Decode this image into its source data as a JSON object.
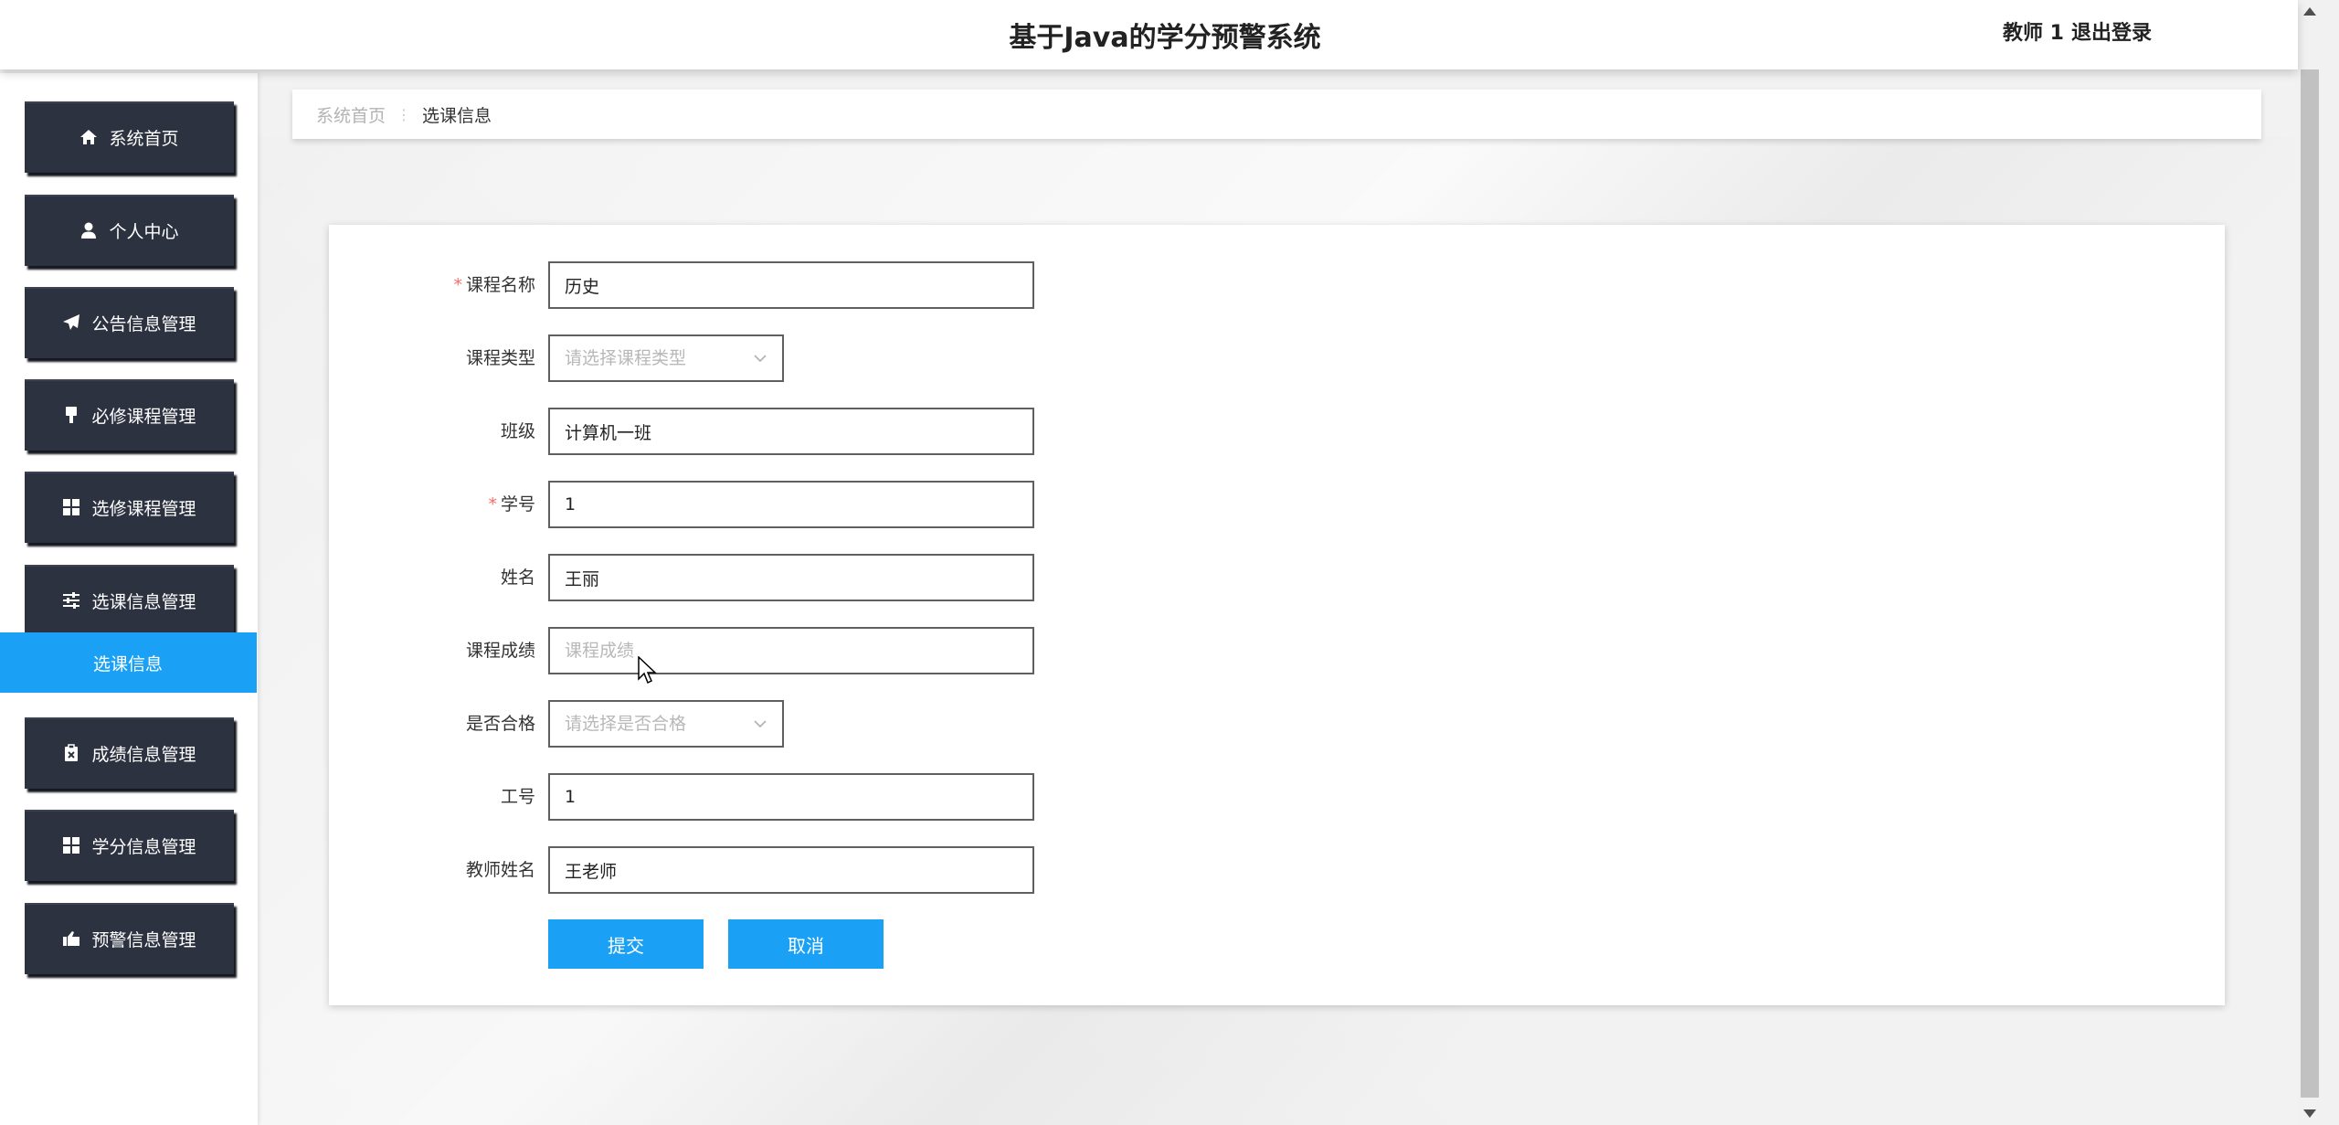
{
  "header": {
    "title": "基于Java的学分预警系统",
    "user": "教师 1",
    "logout": "退出登录"
  },
  "sidebar": {
    "items": [
      {
        "label": "系统首页",
        "icon": "home-icon"
      },
      {
        "label": "个人中心",
        "icon": "user-icon"
      },
      {
        "label": "公告信息管理",
        "icon": "paper-plane-icon"
      },
      {
        "label": "必修课程管理",
        "icon": "brush-icon"
      },
      {
        "label": "选修课程管理",
        "icon": "grid-icon"
      },
      {
        "label": "选课信息管理",
        "icon": "sliders-icon"
      },
      {
        "label": "成绩信息管理",
        "icon": "clipboard-icon"
      },
      {
        "label": "学分信息管理",
        "icon": "grid-icon"
      },
      {
        "label": "预警信息管理",
        "icon": "megaphone-icon"
      }
    ],
    "active_sub": "选课信息"
  },
  "breadcrumb": {
    "home": "系统首页",
    "separator": "⋮",
    "current": "选课信息"
  },
  "form": {
    "course_name": {
      "label": "课程名称",
      "value": "历史",
      "required": true
    },
    "course_type": {
      "label": "课程类型",
      "placeholder": "请选择课程类型"
    },
    "class": {
      "label": "班级",
      "value": "计算机一班"
    },
    "student_id": {
      "label": "学号",
      "value": "1",
      "required": true
    },
    "name": {
      "label": "姓名",
      "value": "王丽"
    },
    "score": {
      "label": "课程成绩",
      "placeholder": "课程成绩"
    },
    "passed": {
      "label": "是否合格",
      "placeholder": "请选择是否合格"
    },
    "teacher_id": {
      "label": "工号",
      "value": "1"
    },
    "teacher_name": {
      "label": "教师姓名",
      "value": "王老师"
    },
    "required_mark": "*",
    "submit": "提交",
    "cancel": "取消"
  },
  "colors": {
    "accent": "#1aa0f5",
    "sidebar_item": "#2d3240",
    "required": "#f56c6c"
  }
}
